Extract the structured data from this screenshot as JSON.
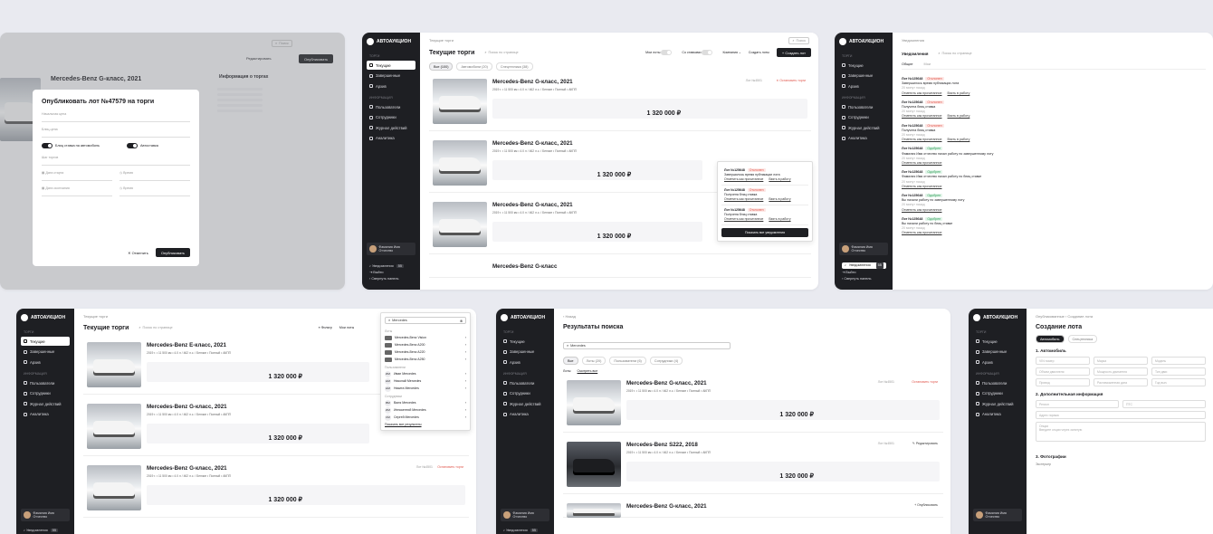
{
  "app": {
    "logo": "АВТОАУКЦИОН"
  },
  "sidebar": {
    "sections": [
      "ТОРГИ",
      "ИНФОРМАЦИЯ"
    ],
    "items": [
      "Текущие",
      "Завершенные",
      "Архив",
      "Пользователи",
      "Сотрудники",
      "Журнал действий",
      "Аналитика"
    ],
    "user": "Фамилия Имя Отчество",
    "notifications": "Уведомления",
    "notif_count": "55",
    "logout": "Выйти",
    "collapse": "Свернуть панель"
  },
  "lots": {
    "title_gclass": "Mercedes-Benz G-класс, 2021",
    "title_eclass": "Mercedes-Benz E-класс, 2021",
    "title_s": "Mercedes-Benz S222, 2018",
    "title_gshort": "Mercedes-Benz G-класс",
    "meta": "2019 г. • 11 500 км • 4.0 л / 462 л.с. / Бензин • Полный • АКПП",
    "price": "1 320 000 ₽",
    "lot_num": "Лот №4501",
    "stop": "Остановить торги",
    "edit": "Редактировать",
    "publish": "Опубликовать"
  },
  "screen1": {
    "car_title": "Mercedes-Benz G-класс, 2021",
    "info_title": "Информация о торгах",
    "edit": "Редактировать",
    "publish": "Опубликовать",
    "modal": {
      "title": "Опубликовать лот №47579 на торги",
      "start_price": "Начальная цена",
      "blitz_price": "Блиц-цена",
      "toggle1": "Блиц ставка на автомобиль",
      "toggle2": "Автоставка",
      "step": "Шаг торгов",
      "date_from": "Дата старта",
      "time_from": "Время",
      "date_to": "Дата окончания",
      "time_to": "Время",
      "cancel": "Отменить",
      "confirm": "Опубликовать"
    }
  },
  "screen2": {
    "breadcrumb": "Текущие торги",
    "title": "Текущие торги",
    "search": "Поиск по странице",
    "tabs": [
      "Все (100)",
      "Автомобили (20)",
      "Спецтехника (38)"
    ],
    "toggle_mine": "Мои лоты",
    "toggle_bid": "Со ставками",
    "company": "Компания",
    "create_lots": "Создать лоты",
    "create_lot": "Создать лот",
    "search_top": "Поиск",
    "notifs": [
      {
        "lot": "Лот №125648",
        "tag": "Отклонен",
        "text": "Завершилось время публикации лота",
        "link1": "Отметить как прочитанное",
        "link2": "Взять в работу"
      },
      {
        "lot": "Лот №125648",
        "tag": "Отклонен",
        "text": "Получена блиц ставка",
        "link1": "Отметить как прочитанное",
        "link2": "Взять в работу"
      },
      {
        "lot": "Лот №125648",
        "tag": "Отклонен",
        "text": "Получена блиц ставка",
        "link1": "Отметить как прочитанное",
        "link2": "Взять в работу"
      }
    ],
    "show_all": "Показать все уведомления"
  },
  "screen3": {
    "breadcrumb": "Уведомления",
    "title": "Уведомления",
    "search": "Поиск по странице",
    "tabs": [
      "Общие",
      "Мои"
    ],
    "items": [
      {
        "lot": "Лот №125648",
        "tag": "Отклонен",
        "ok": false,
        "text": "Завершилось время публикации лота"
      },
      {
        "lot": "Лот №125648",
        "tag": "Отклонен",
        "ok": false,
        "text": "Получена блиц ставка"
      },
      {
        "lot": "Лот №125648",
        "tag": "Отклонен",
        "ok": false,
        "text": "Получена блиц ставка"
      },
      {
        "lot": "Лот №125648",
        "tag": "Одобрен",
        "ok": true,
        "text": "Фамилия Имя отчество начал работу по завершенному лоту"
      },
      {
        "lot": "Лот №125648",
        "tag": "Одобрен",
        "ok": true,
        "text": "Фамилия Имя отчество начал работу по блиц ставке"
      },
      {
        "lot": "Лот №125648",
        "tag": "Одобрен",
        "ok": true,
        "text": "Вы начали работу по завершенному лоту"
      },
      {
        "lot": "Лот №125648",
        "tag": "Одобрен",
        "ok": true,
        "text": "Вы начали работу по блиц ставке"
      }
    ],
    "link1": "Отметить как прочитанное",
    "link2": "Взять в работу",
    "time": "20 минут назад"
  },
  "screen4": {
    "breadcrumb": "Текущие торги",
    "title": "Текущие торги",
    "search": "Поиск по странице",
    "filter": "Фильтр",
    "toggle_mine": "Мои лоты",
    "query": "Mercedes",
    "dd_lots": "Лоты",
    "dd_users": "Пользователи",
    "dd_staff": "Сотрудники",
    "lot_rows": [
      "Mercedes-Benz Vision",
      "Mercedes-Benz A200",
      "Mercedes-Benz A220",
      "Mercedes-Benz A250"
    ],
    "user_rows": [
      {
        "i": "ИМ",
        "n": "Иван Mercedes"
      },
      {
        "i": "НМ",
        "n": "Николай Mercedes"
      },
      {
        "i": "НМ",
        "n": "Никита Mercedes"
      }
    ],
    "staff_rows": [
      {
        "i": "ВМ",
        "n": "Валя Mercedes"
      },
      {
        "i": "ИМ",
        "n": "Иннокентий Mercedes"
      },
      {
        "i": "СМ",
        "n": "Сергей Mercedes"
      }
    ],
    "show_all": "Показать все результаты"
  },
  "screen5": {
    "back": "Назад",
    "title": "Результаты поиска",
    "query": "Mercedes",
    "tabs": [
      "Все",
      "Лоты (20)",
      "Пользователи (6)",
      "Сотрудники (4)"
    ],
    "sub_tabs": [
      "Лоты",
      "Смотреть все"
    ]
  },
  "screen6": {
    "breadcrumb": "Опубликованные",
    "crumb2": "Создание лота",
    "title": "Создание лота",
    "tabs": [
      "Автомобиль",
      "Спецтехника"
    ],
    "sec1": "1. Автомобиль",
    "fields1": [
      "VIN номер",
      "Марка",
      "Модель",
      "Объем двигателя",
      "Мощность двигателя",
      "Тип двиг.",
      "Привод",
      "Растаможенная дата",
      "Год вып."
    ],
    "sec2": "2. Дополнительная информация",
    "fields2": [
      "Регион",
      "ПТС",
      "Адрес гаража",
      "Опции"
    ],
    "options_hint": "Введите опции через запятую",
    "sec3": "3. Фотографии",
    "sec3_hint": "Экстерьер"
  }
}
